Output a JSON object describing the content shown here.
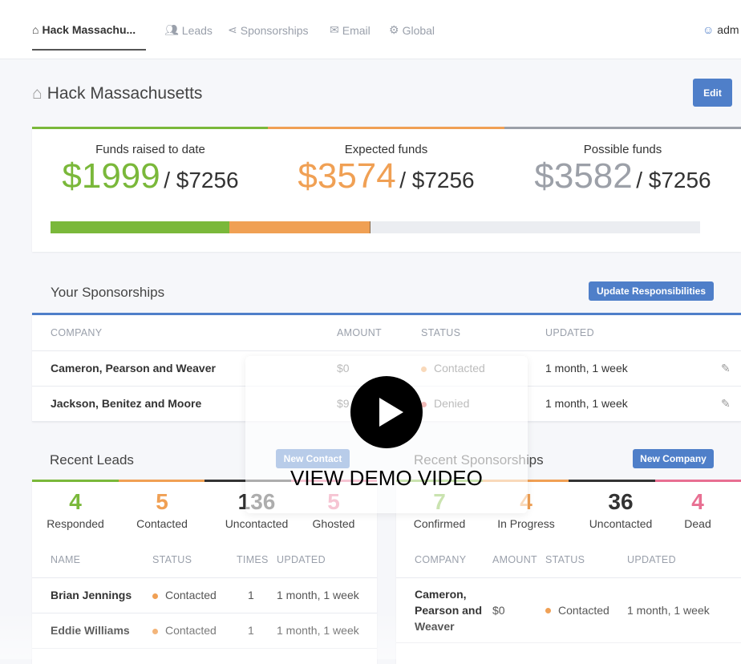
{
  "nav": {
    "items": [
      {
        "label": "Hack Massachu...",
        "icon": "home-icon"
      },
      {
        "label": "Leads",
        "icon": "users-icon"
      },
      {
        "label": "Sponsorships",
        "icon": "share-icon"
      },
      {
        "label": "Email",
        "icon": "mail-icon"
      },
      {
        "label": "Global",
        "icon": "gear-icon"
      }
    ],
    "user": "adm"
  },
  "page": {
    "title": "Hack Massachusetts",
    "edit": "Edit"
  },
  "funds": [
    {
      "label": "Funds raised to date",
      "value": "$1999",
      "total": "/ $7256",
      "color": "#7ab83a"
    },
    {
      "label": "Expected funds",
      "value": "$3574",
      "total": "/ $7256",
      "color": "#f0a054"
    },
    {
      "label": "Possible funds",
      "value": "$3582",
      "total": "/ $7256",
      "color": "#9ca0a8"
    }
  ],
  "progress": {
    "raised_pct": 27.5,
    "expected_pct": 49.3
  },
  "your_sponsorships": {
    "title": "Your Sponsorships",
    "button": "Update Responsibilities",
    "headers": [
      "COMPANY",
      "AMOUNT",
      "STATUS",
      "UPDATED"
    ],
    "rows": [
      {
        "company": "Cameron, Pearson and Weaver",
        "amount": "$0",
        "status": "Contacted",
        "status_color": "#f0a054",
        "updated": "1 month, 1 week"
      },
      {
        "company": "Jackson, Benitez and Moore",
        "amount": "$9",
        "status": "Denied",
        "status_color": "#d9534f",
        "updated": "1 month, 1 week"
      }
    ]
  },
  "recent_leads": {
    "title": "Recent Leads",
    "button": "New Contact",
    "stats": [
      {
        "n": "4",
        "label": "Responded",
        "color": "#7ab83a"
      },
      {
        "n": "5",
        "label": "Contacted",
        "color": "#f0a054"
      },
      {
        "n": "136",
        "label": "Uncontacted",
        "color": "#333"
      },
      {
        "n": "5",
        "label": "Ghosted",
        "color": "#e86f92"
      }
    ],
    "headers": [
      "NAME",
      "STATUS",
      "TIMES",
      "UPDATED"
    ],
    "rows": [
      {
        "name": "Brian Jennings",
        "status": "Contacted",
        "times": "1",
        "updated": "1 month, 1 week"
      },
      {
        "name": "Eddie Williams",
        "status": "Contacted",
        "times": "1",
        "updated": "1 month, 1 week"
      }
    ]
  },
  "recent_sponsorships": {
    "title": "Recent Sponsorships",
    "button": "New Company",
    "stats": [
      {
        "n": "7",
        "label": "Confirmed",
        "color": "#7ab83a"
      },
      {
        "n": "4",
        "label": "In Progress",
        "color": "#f0a054"
      },
      {
        "n": "36",
        "label": "Uncontacted",
        "color": "#333"
      },
      {
        "n": "4",
        "label": "Dead",
        "color": "#e86f92"
      }
    ],
    "headers": [
      "COMPANY",
      "AMOUNT",
      "STATUS",
      "UPDATED"
    ],
    "rows": [
      {
        "company": "Cameron, Pearson and Weaver",
        "amount": "$0",
        "status": "Contacted",
        "updated": "1 month, 1 week"
      }
    ]
  },
  "video": {
    "label": "VIEW DEMO VIDEO"
  }
}
